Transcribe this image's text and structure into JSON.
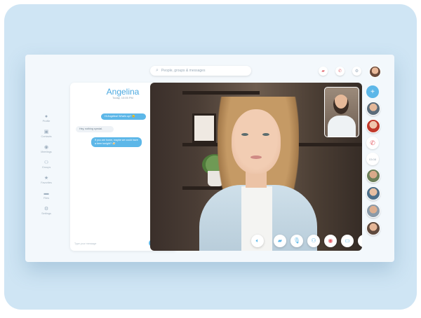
{
  "search": {
    "placeholder": "People, groups & messages"
  },
  "top_actions": [
    {
      "icon": "video-icon"
    },
    {
      "icon": "phone-icon"
    },
    {
      "icon": "gear-icon"
    }
  ],
  "nav": [
    {
      "label": "Profile",
      "icon": "user-icon"
    },
    {
      "label": "Contacts",
      "icon": "contacts-icon"
    },
    {
      "label": "Meetings",
      "icon": "meetings-icon"
    },
    {
      "label": "Groups",
      "icon": "groups-icon"
    },
    {
      "label": "Favorites",
      "icon": "star-icon"
    },
    {
      "label": "Files",
      "icon": "folder-icon"
    },
    {
      "label": "Settings",
      "icon": "gear-icon"
    }
  ],
  "chat": {
    "name": "Angelina",
    "subtitle": "Today, 10:05 PM",
    "messages": [
      {
        "from": "me",
        "text": "Hi Angelina! What's up? 😊"
      },
      {
        "from": "them",
        "text": "Hey, nothing special."
      },
      {
        "from": "me",
        "text": "If you are home, maybe we could have a beer tonight? 🍻"
      }
    ],
    "input_placeholder": "Type your message",
    "send_label": "Send"
  },
  "call": {
    "participants_rail": {
      "time": "03:08"
    }
  },
  "colors": {
    "accent": "#5db7e8",
    "hangup": "#ea4b55",
    "backdrop": "#cfe5f4"
  }
}
